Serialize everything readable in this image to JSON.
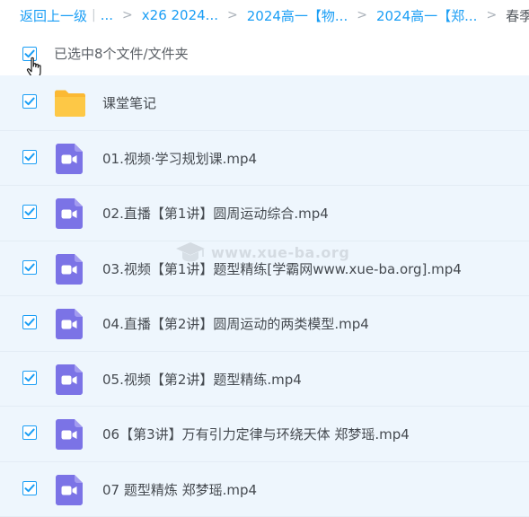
{
  "breadcrumb": {
    "back_label": "返回上一级",
    "sep": "|",
    "ellipsis": "...",
    "items": [
      "x26 2024...",
      "2024高一【物...",
      "2024高一【郑..."
    ],
    "current": "春季班"
  },
  "selection": {
    "checked": true,
    "label": "已选中8个文件/文件夹"
  },
  "files": [
    {
      "type": "folder",
      "name": "课堂笔记",
      "checked": true
    },
    {
      "type": "video",
      "name": "01.视频·学习规划课.mp4",
      "checked": true
    },
    {
      "type": "video",
      "name": "02.直播【第1讲】圆周运动综合.mp4",
      "checked": true
    },
    {
      "type": "video",
      "name": "03.视频【第1讲】题型精练[学霸网www.xue-ba.org].mp4",
      "checked": true
    },
    {
      "type": "video",
      "name": "04.直播【第2讲】圆周运动的两类模型.mp4",
      "checked": true
    },
    {
      "type": "video",
      "name": "05.视频【第2讲】题型精练.mp4",
      "checked": true
    },
    {
      "type": "video",
      "name": "06【第3讲】万有引力定律与环绕天体 郑梦瑶.mp4",
      "checked": true
    },
    {
      "type": "video",
      "name": "07 题型精炼 郑梦瑶.mp4",
      "checked": true
    }
  ],
  "watermark": {
    "text": "www.xue-ba.org"
  },
  "colors": {
    "link": "#1a9ef5",
    "row_selected_bg": "#eef6fd",
    "checkbox": "#1a9ef5",
    "folder": "#fdc846",
    "video_icon": "#7b73e6"
  },
  "icons": {
    "checkbox": "check-icon",
    "folder": "folder-icon",
    "video": "video-file-icon",
    "cursor": "hand-pointer-icon"
  }
}
